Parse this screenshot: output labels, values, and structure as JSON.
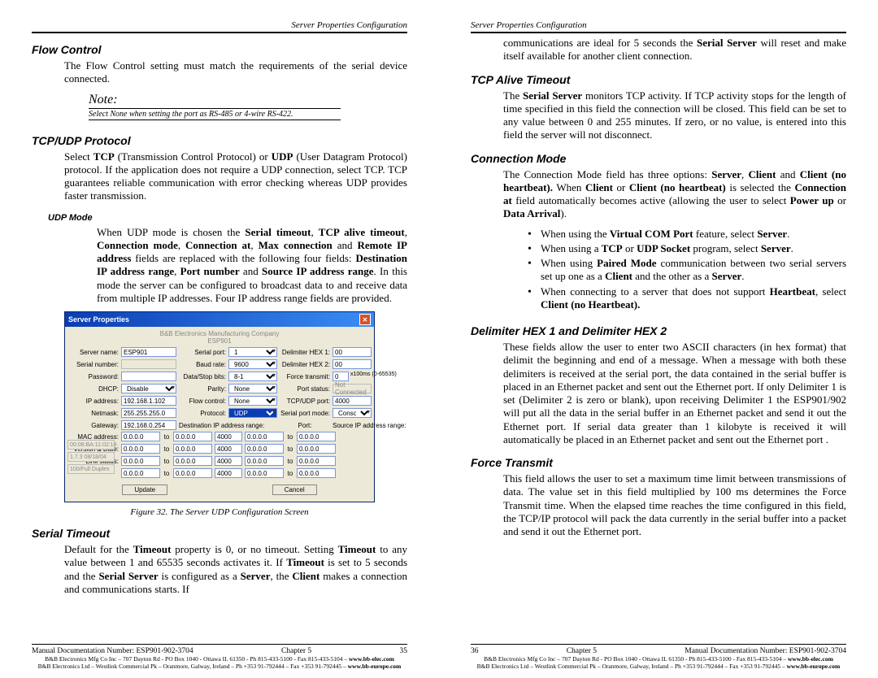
{
  "header": {
    "title": "Server Properties Configuration"
  },
  "left": {
    "h_flow": "Flow Control",
    "flow_p": "The Flow Control setting must match the requirements of the serial device connected.",
    "note_title": "Note:",
    "note_txt": "Select None when setting the port as RS-485 or 4-wire RS-422.",
    "h_tcpudp": "TCP/UDP Protocol",
    "tcpudp_p": "Select TCP (Transmission Control Protocol) or UDP (User Datagram Protocol) protocol. If the application does not require a UDP connection, select TCP. TCP guarantees reliable communication with error checking whereas UDP provides faster transmission.",
    "h_udpmode": "UDP Mode",
    "udpmode_p": "When UDP mode is chosen the Serial timeout, TCP alive timeout, Connection mode, Connection at, Max connection and Remote IP address fields are replaced with the following four fields: Destination IP address range, Port number and Source IP address range. In this mode the server can be configured to broadcast data to and receive data from multiple IP addresses. Four IP address range fields are provided.",
    "figcap": "Figure 32.    The Server UDP Configuration Screen",
    "h_serialto": "Serial Timeout",
    "serialto_p": "Default for the Timeout property is 0, or no timeout. Setting Timeout to any value between 1 and 65535 seconds activates it. If Timeout is set to 5 seconds and the Serial Server is configured as a Server, the Client makes a connection and communications starts. If"
  },
  "right": {
    "cont_p": "communications are ideal for 5 seconds the Serial Server will reset and make itself available for another client connection.",
    "h_tcpalive": "TCP Alive Timeout",
    "tcpalive_p": "The Serial Server monitors TCP activity. If TCP activity stops for the length of time specified in this field the connection will be closed. This field can be set to any value between 0 and 255 minutes. If zero, or no value, is entered into this field the server will not disconnect.",
    "h_conn": "Connection Mode",
    "conn_p": "The Connection Mode field has three options: Server, Client and Client (no heartbeat). When Client or Client (no heartbeat) is selected the Connection at field automatically becomes active (allowing the user to select Power up or Data Arrival).",
    "bul1": "When using the Virtual COM Port feature, select Server.",
    "bul2": "When using a TCP or UDP Socket program, select Server.",
    "bul3": "When using Paired Mode communication between two serial servers set up one as a Client and the other as a Server.",
    "bul4": "When connecting to a server that does not support Heartbeat, select Client (no Heartbeat).",
    "h_delim": "Delimiter HEX 1 and Delimiter HEX 2",
    "delim_p": "These fields allow the user to enter two ASCII characters (in hex format) that delimit the beginning and end of a message. When a message with both these delimiters is received at the serial port, the data contained in the serial buffer is placed in an Ethernet packet and sent out the Ethernet port. If only Delimiter 1 is set (Delimiter 2 is zero or blank), upon receiving Delimiter 1 the ESP901/902 will put all the data in the serial buffer in an Ethernet packet and send it out the Ethernet port. If serial data greater than 1 kilobyte is received it will automatically be placed in an Ethernet packet and sent out the Ethernet port .",
    "h_force": "Force Transmit",
    "force_p": "This field allows the user to set a maximum time limit between transmissions of data. The value set in this field multiplied by 100 ms determines the Force Transmit time. When the elapsed time reaches the time configured in this field, the TCP/IP protocol will pack the data currently in the serial buffer into a packet and send it out the Ethernet port."
  },
  "dialog": {
    "title": "Server Properties",
    "company": "B&B Electronics Manufacturing Company",
    "model": "ESP901",
    "labels": {
      "server_name": "Server name:",
      "serial_port": "Serial port:",
      "delim1": "Delimiter HEX 1:",
      "serial_no": "Serial number:",
      "baud": "Baud rate:",
      "delim2": "Delimiter HEX 2:",
      "password": "Password:",
      "dsb": "Data/Stop bits:",
      "forcetx": "Force transmit:",
      "dhcp": "DHCP:",
      "parity": "Parity:",
      "portstat": "Port status:",
      "ip": "IP address:",
      "flow": "Flow control:",
      "tcpudpport": "TCP/UDP port:",
      "netmask": "Netmask:",
      "protocol": "Protocol:",
      "spm": "Serial port mode:",
      "gateway": "Gateway:",
      "dest": "Destination IP address range:",
      "port": "Port:",
      "src": "Source IP address range:",
      "mac": "MAC address:",
      "ver": "Version & Date:",
      "link": "Link status:",
      "to": "to",
      "update": "Update",
      "cancel": "Cancel"
    },
    "vals": {
      "server_name": "ESP901",
      "serial_port": "1",
      "d1": "00",
      "serial_no": "",
      "baud": "9600",
      "d2": "00",
      "password": "",
      "dsb": "8-1",
      "ftx": "0",
      "ftx_unit": "x100ms (0-65535)",
      "dhcp": "Disable",
      "parity": "None",
      "portstat": "Not Connected",
      "ip": "192.168.1.102",
      "flow": "None",
      "tcpudpport": "4000",
      "netmask": "255.255.255.0",
      "protocol": "UDP",
      "spm": "Console",
      "gateway": "192.168.0.254",
      "mac": "00:08:BA:11:02:14",
      "ver": "1.7.3 08/18/04",
      "link": "100/Full Duplex",
      "r1a": "0.0.0.0",
      "r1b": "0.0.0.0",
      "p1": "4000",
      "s1a": "0.0.0.0",
      "s1b": "0.0.0.0",
      "r2a": "0.0.0.0",
      "r2b": "0.0.0.0",
      "p2": "4000",
      "s2a": "0.0.0.0",
      "s2b": "0.0.0.0",
      "r3a": "0.0.0.0",
      "r3b": "0.0.0.0",
      "p3": "4000",
      "s3a": "0.0.0.0",
      "s3b": "0.0.0.0",
      "r4a": "0.0.0.0",
      "r4b": "0.0.0.0",
      "p4": "4000",
      "s4a": "0.0.0.0",
      "s4b": "0.0.0.0"
    }
  },
  "footer": {
    "doc": "Manual Documentation Number: ESP901-902-3704",
    "chap": "Chapter 5",
    "pg_l": "35",
    "pg_r": "36",
    "line1": "B&B Electronics Mfg Co Inc – 707 Dayton Rd - PO Box 1040 - Ottawa IL 61350 - Ph 815-433-5100 - Fax 815-433-5104 – www.bb-elec.com",
    "line2": "B&B Electronics Ltd – Westlink Commercial Pk – Oranmore, Galway, Ireland – Ph +353 91-792444 – Fax +353 91-792445 – www.bb-europe.com"
  }
}
